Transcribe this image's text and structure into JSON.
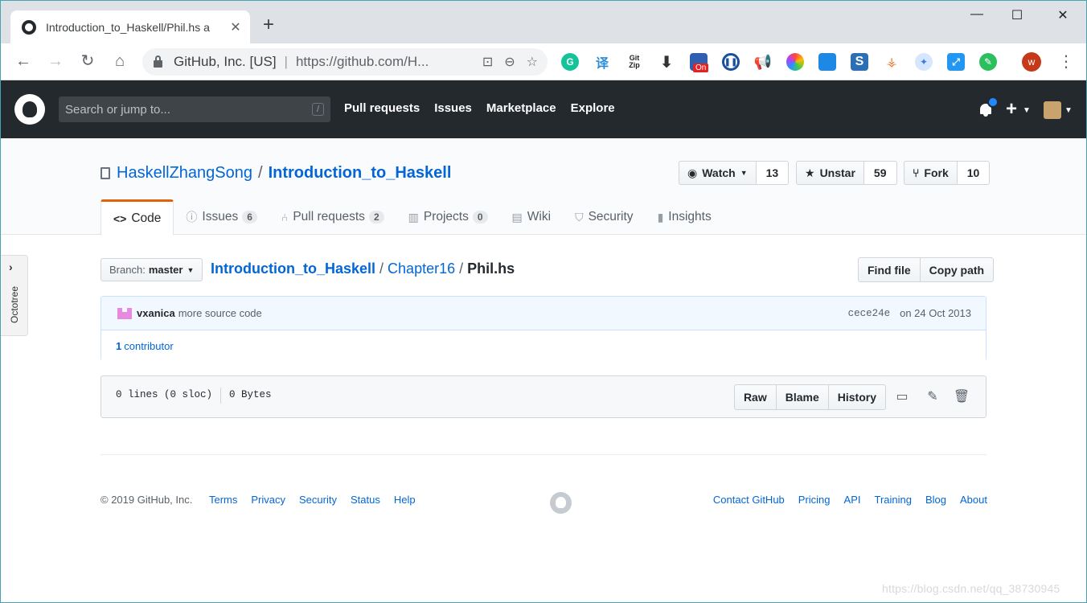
{
  "browser": {
    "tab_title": "Introduction_to_Haskell/Phil.hs a",
    "tab_close": "✕",
    "new_tab": "+",
    "window_controls": {
      "minimize": "—",
      "maximize": "☐",
      "close": "✕"
    },
    "nav": {
      "back": "←",
      "forward": "→",
      "reload": "↻",
      "home": "⌂"
    },
    "omnibox": {
      "org": "GitHub, Inc. [US]",
      "separator": "|",
      "url": "https://github.com/H..."
    },
    "profile_initial": "w",
    "extensions": [
      "grammarly-icon",
      "translate-icon",
      "gitzip-icon",
      "download-icon",
      "on-icon",
      "pause-icon",
      "megaphone-icon",
      "photos-icon",
      "cube-icon",
      "s-icon",
      "sitemap-icon",
      "bird-icon",
      "resize-icon",
      "evernote-icon"
    ],
    "extension_badge": "On",
    "ext_labels": {
      "translate": "译",
      "gitzip": "Git Zip",
      "s": "S"
    }
  },
  "github": {
    "search_placeholder": "Search or jump to...",
    "search_hotkey": "/",
    "nav": [
      "Pull requests",
      "Issues",
      "Marketplace",
      "Explore"
    ],
    "colors": {
      "header_bg": "#24292e",
      "link": "#0366d6",
      "tab_accent": "#e36209"
    }
  },
  "repo": {
    "owner": "HaskellZhangSong",
    "separator": "/",
    "name": "Introduction_to_Haskell",
    "watch": {
      "label": "Watch",
      "count": "13"
    },
    "star": {
      "label": "Unstar",
      "count": "59"
    },
    "fork": {
      "label": "Fork",
      "count": "10"
    },
    "tabs": [
      {
        "label": "Code",
        "counter": ""
      },
      {
        "label": "Issues",
        "counter": "6"
      },
      {
        "label": "Pull requests",
        "counter": "2"
      },
      {
        "label": "Projects",
        "counter": "0"
      },
      {
        "label": "Wiki",
        "counter": ""
      },
      {
        "label": "Security",
        "counter": ""
      },
      {
        "label": "Insights",
        "counter": ""
      }
    ]
  },
  "octotree": {
    "label": "Octotree"
  },
  "file_nav": {
    "branch_prefix": "Branch:",
    "branch": "master",
    "breadcrumb": {
      "root": "Introduction_to_Haskell",
      "folder": "Chapter16",
      "file": "Phil.hs",
      "sep": "/"
    },
    "find_file": "Find file",
    "copy_path": "Copy path"
  },
  "commit": {
    "author": "vxanica",
    "message": "more source code",
    "sha": "cece24e",
    "date": "on 24 Oct 2013",
    "contributors_count": "1",
    "contributors_label": "contributor"
  },
  "file": {
    "lines": "0 lines (0 sloc)",
    "size": "0 Bytes",
    "buttons": [
      "Raw",
      "Blame",
      "History"
    ]
  },
  "footer": {
    "copyright": "© 2019 GitHub, Inc.",
    "left_links": [
      "Terms",
      "Privacy",
      "Security",
      "Status",
      "Help"
    ],
    "right_links": [
      "Contact GitHub",
      "Pricing",
      "API",
      "Training",
      "Blog",
      "About"
    ]
  },
  "watermark": "https://blog.csdn.net/qq_38730945"
}
